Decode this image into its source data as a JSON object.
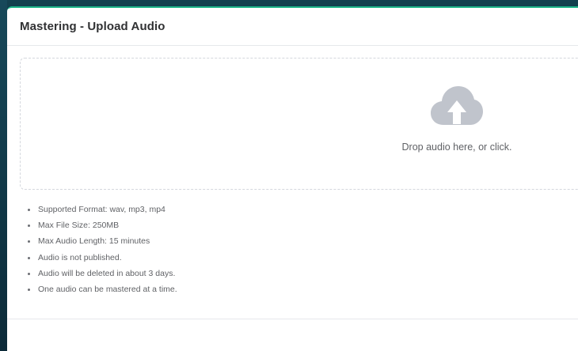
{
  "dialog": {
    "title": "Mastering - Upload Audio"
  },
  "dropzone": {
    "icon": "cloud-upload-icon",
    "text": "Drop audio here, or click."
  },
  "info": [
    "Supported Format: wav, mp3, mp4",
    "Max File Size: 250MB",
    "Max Audio Length: 15 minutes",
    "Audio is not published.",
    "Audio will be deleted in about 3 days.",
    "One audio can be mastered at a time."
  ],
  "colors": {
    "accent": "#1fb68a",
    "icon": "#c0c4cc",
    "text": "#606266",
    "title": "#303133"
  }
}
